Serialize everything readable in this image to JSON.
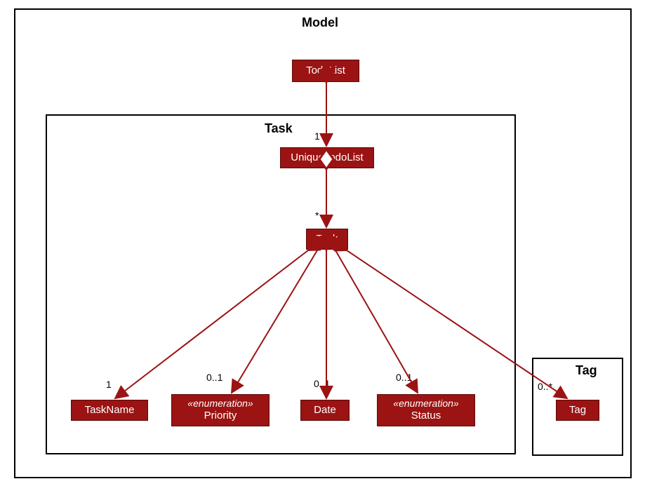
{
  "packages": {
    "model": "Model",
    "task": "Task",
    "tag": "Tag"
  },
  "classes": {
    "todolist": "TodoList",
    "uniquetodolist": "UniqueTodoList",
    "task": "Task",
    "taskname": "TaskName",
    "priority_stereo": "«enumeration»",
    "priority": "Priority",
    "date": "Date",
    "status_stereo": "«enumeration»",
    "status": "Status",
    "tag": "Tag"
  },
  "multiplicities": {
    "utl": "1",
    "task": "*",
    "taskname": "1",
    "priority": "0..1",
    "date": "0..1",
    "status": "0..1",
    "tag": "0..*"
  }
}
